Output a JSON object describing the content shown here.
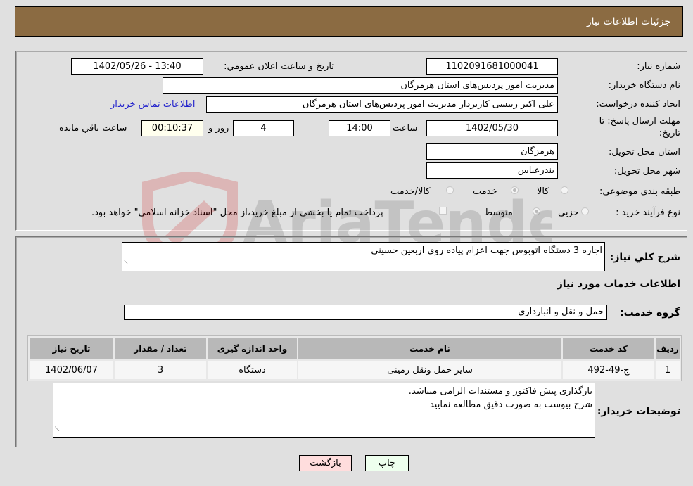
{
  "header": {
    "title": "جزئیات اطلاعات نیاز"
  },
  "form": {
    "need_number": {
      "label": "شماره نیاز:",
      "value": "1102091681000041"
    },
    "announce_datetime": {
      "label": "تاریخ و ساعت اعلان عمومي:",
      "value": "1402/05/26 - 13:40"
    },
    "buyer_org": {
      "label": "نام دستگاه خریدار:",
      "value": "مدیریت امور پردیس‌های استان هرمزگان"
    },
    "requester": {
      "label": "ایجاد کننده درخواست:",
      "value": "علی اکبر رییسی کاربرداز مدیریت امور پردیس‌های استان هرمزگان",
      "contact_link": "اطلاعات تماس خریدار"
    },
    "deadline": {
      "label_line1": "مهلت ارسال پاسخ: تا",
      "label_line2": "تاریخ:",
      "date": "1402/05/30",
      "time_label": "ساعت",
      "time": "14:00",
      "days": "4",
      "days_label": "روز و",
      "remaining": "00:10:37",
      "remaining_label": "ساعت باقي مانده"
    },
    "delivery_province": {
      "label": "استان محل تحویل:",
      "value": "هرمزگان"
    },
    "delivery_city": {
      "label": "شهر محل تحویل:",
      "value": "بندرعباس"
    },
    "category": {
      "label": "طبقه بندی موضوعی:",
      "options": [
        "کالا",
        "خدمت",
        "کالا/خدمت"
      ],
      "selected": "خدمت"
    },
    "purchase_type": {
      "label": "نوع فرآیند خرید :",
      "options": [
        "جزيي",
        "متوسط"
      ],
      "selected": "متوسط",
      "treasury_note": "پرداخت تمام یا بخشی از مبلغ خرید،از محل \"اسناد خزانه اسلامی\" خواهد بود."
    }
  },
  "details": {
    "summary_label": "شرح کلي نياز:",
    "summary_value": "اجاره 3 دستگاه اتوبوس جهت اعزام پیاده روی اربعین حسینی",
    "services_title": "اطلاعات خدمات مورد نياز",
    "service_group_label": "گروه خدمت:",
    "service_group_value": "حمل و نقل و انبارداری",
    "table": {
      "headers": [
        "ردیف",
        "کد خدمت",
        "نام خدمت",
        "واحد اندازه گیری",
        "تعداد / مقدار",
        "تاریخ نیاز"
      ],
      "rows": [
        [
          "1",
          "ج-49-492",
          "سایر حمل ونقل زمینی",
          "دستگاه",
          "3",
          "1402/06/07"
        ]
      ]
    },
    "buyer_notes_label": "توضیحات خریدار:",
    "buyer_notes_line1": "بارگذاری پیش فاکتور و مستندات الزامی میباشد.",
    "buyer_notes_line2": "شرح بیوست به صورت دقیق مطالعه نمایید"
  },
  "buttons": {
    "print": "چاپ",
    "back": "بازگشت"
  },
  "watermark": {
    "text": "AriaTender.neT"
  },
  "colors": {
    "header_bg": "#8b6b42",
    "print_bg": "#eeffee",
    "back_bg": "#ffdddd",
    "link": "#2222cc"
  }
}
